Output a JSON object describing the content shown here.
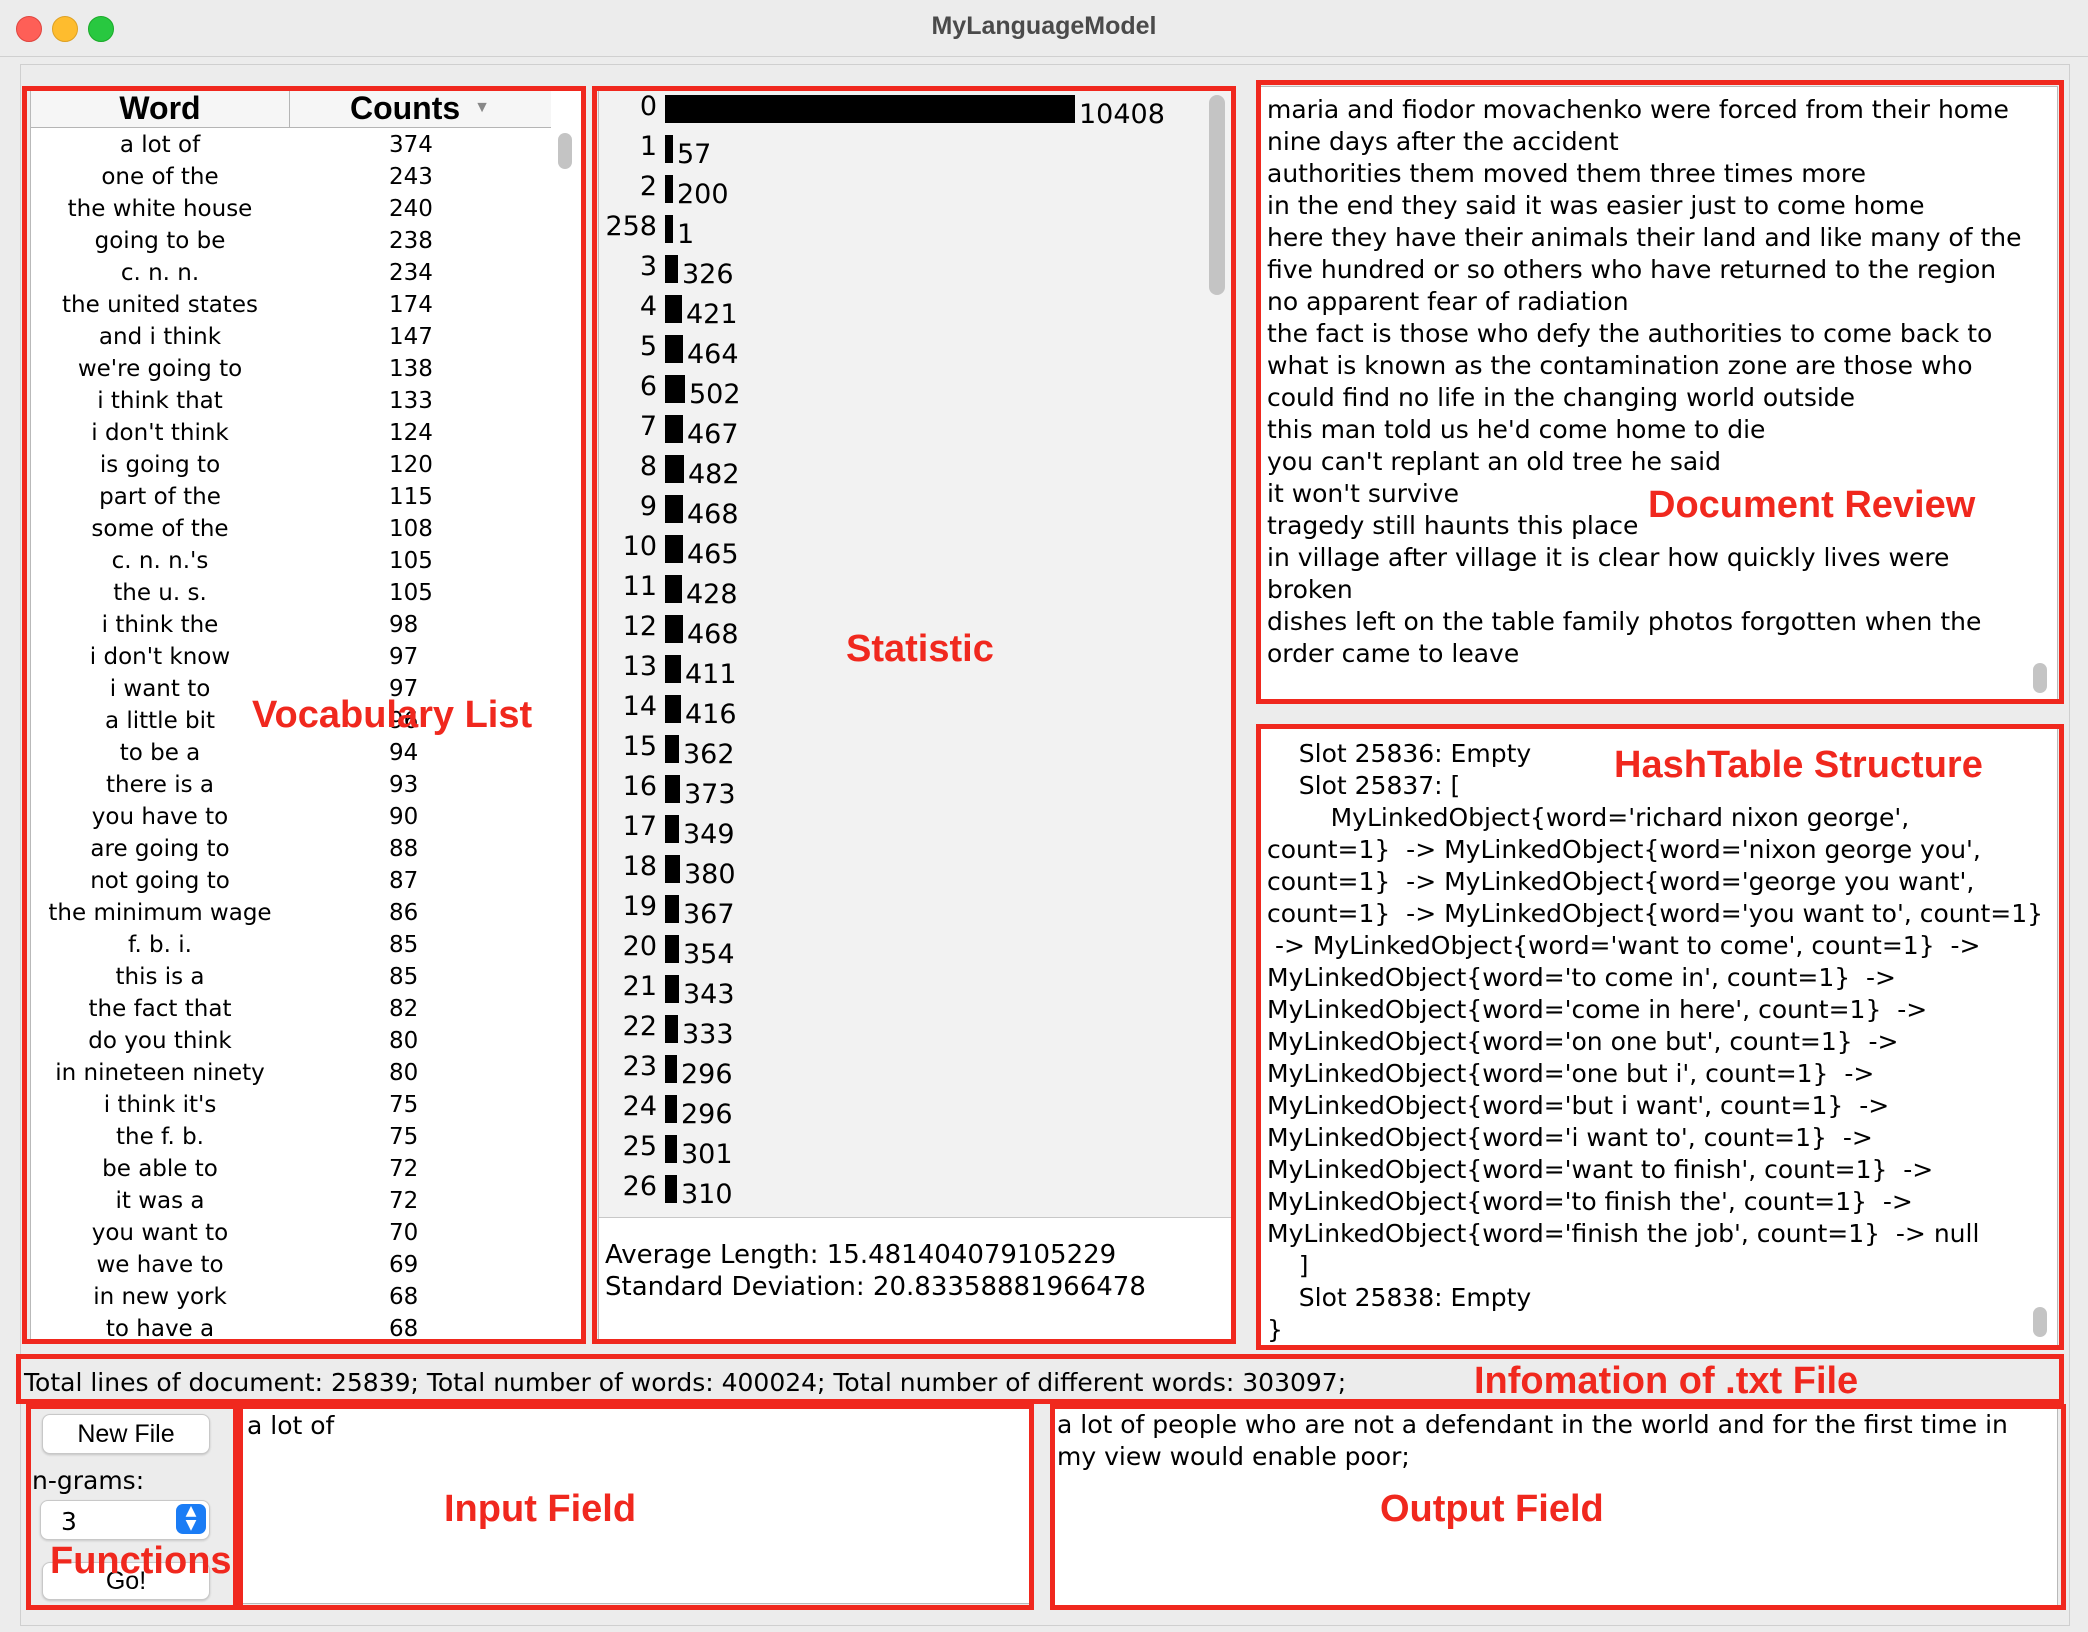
{
  "window": {
    "title": "MyLanguageModel"
  },
  "vocab": {
    "headers": {
      "word": "Word",
      "count": "Counts"
    },
    "rows": [
      [
        "a lot of",
        "374"
      ],
      [
        "one of the",
        "243"
      ],
      [
        "the white house",
        "240"
      ],
      [
        "going to be",
        "238"
      ],
      [
        "c. n. n.",
        "234"
      ],
      [
        "the united states",
        "174"
      ],
      [
        "and i think",
        "147"
      ],
      [
        "we're going to",
        "138"
      ],
      [
        "i think that",
        "133"
      ],
      [
        "i don't think",
        "124"
      ],
      [
        "is going to",
        "120"
      ],
      [
        "part of the",
        "115"
      ],
      [
        "some of the",
        "108"
      ],
      [
        "c. n. n.'s",
        "105"
      ],
      [
        "the u. s.",
        "105"
      ],
      [
        "i think the",
        "98"
      ],
      [
        "i don't know",
        "97"
      ],
      [
        "i want to",
        "97"
      ],
      [
        "a little bit",
        "96"
      ],
      [
        "to be a",
        "94"
      ],
      [
        "there is a",
        "93"
      ],
      [
        "you have to",
        "90"
      ],
      [
        "are going to",
        "88"
      ],
      [
        "not going to",
        "87"
      ],
      [
        "the minimum wage",
        "86"
      ],
      [
        "f. b. i.",
        "85"
      ],
      [
        "this is a",
        "85"
      ],
      [
        "the fact that",
        "82"
      ],
      [
        "do you think",
        "80"
      ],
      [
        "in nineteen ninety",
        "80"
      ],
      [
        "i think it's",
        "75"
      ],
      [
        "the f. b.",
        "75"
      ],
      [
        "be able to",
        "72"
      ],
      [
        "it was a",
        "72"
      ],
      [
        "you want to",
        "70"
      ],
      [
        "we have to",
        "69"
      ],
      [
        "in new york",
        "68"
      ],
      [
        "to have a",
        "68"
      ]
    ]
  },
  "statistic": {
    "histogram": [
      {
        "length": "0",
        "count": 10408
      },
      {
        "length": "1",
        "count": 57
      },
      {
        "length": "2",
        "count": 200
      },
      {
        "length": "258",
        "count": 1
      },
      {
        "length": "3",
        "count": 326
      },
      {
        "length": "4",
        "count": 421
      },
      {
        "length": "5",
        "count": 464
      },
      {
        "length": "6",
        "count": 502
      },
      {
        "length": "7",
        "count": 467
      },
      {
        "length": "8",
        "count": 482
      },
      {
        "length": "9",
        "count": 468
      },
      {
        "length": "10",
        "count": 465
      },
      {
        "length": "11",
        "count": 428
      },
      {
        "length": "12",
        "count": 468
      },
      {
        "length": "13",
        "count": 411
      },
      {
        "length": "14",
        "count": 416
      },
      {
        "length": "15",
        "count": 362
      },
      {
        "length": "16",
        "count": 373
      },
      {
        "length": "17",
        "count": 349
      },
      {
        "length": "18",
        "count": 380
      },
      {
        "length": "19",
        "count": 367
      },
      {
        "length": "20",
        "count": 354
      },
      {
        "length": "21",
        "count": 343
      },
      {
        "length": "22",
        "count": 333
      },
      {
        "length": "23",
        "count": 296
      },
      {
        "length": "24",
        "count": 296
      },
      {
        "length": "25",
        "count": 301
      },
      {
        "length": "26",
        "count": 310
      }
    ],
    "average": "Average Length: 15.481404079105229",
    "stddev": "Standard Deviation: 20.83358881966478"
  },
  "document": {
    "lines": [
      "maria and fiodor movachenko were forced from their home",
      "nine days after the accident",
      "authorities them moved them three times more",
      "in the end they said it was easier just to come home",
      "here they have their animals their land and like many of the",
      "five hundred or so others who have returned to the region",
      "no apparent fear of radiation",
      "the fact is those who defy the authorities to come back to",
      "what is known as the contamination zone are those who",
      "could find no life in the changing world outside",
      "this man told us he'd come home to die",
      "you can't replant an old tree he said",
      "it won't survive",
      "tragedy still haunts this place",
      "in village after village it is clear how quickly lives were",
      "broken",
      "dishes left on the table family photos forgotten when the",
      "order came to leave"
    ]
  },
  "hashtable": {
    "lines": [
      "    Slot 25836: Empty",
      "    Slot 25837: [",
      "        MyLinkedObject{word='richard nixon george',",
      "count=1}  -> MyLinkedObject{word='nixon george you',",
      "count=1}  -> MyLinkedObject{word='george you want',",
      "count=1}  -> MyLinkedObject{word='you want to', count=1}",
      " -> MyLinkedObject{word='want to come', count=1}  ->",
      "MyLinkedObject{word='to come in', count=1}  ->",
      "MyLinkedObject{word='come in here', count=1}  ->",
      "MyLinkedObject{word='on one but', count=1}  ->",
      "MyLinkedObject{word='one but i', count=1}  ->",
      "MyLinkedObject{word='but i want', count=1}  ->",
      "MyLinkedObject{word='i want to', count=1}  ->",
      "MyLinkedObject{word='want to finish', count=1}  ->",
      "MyLinkedObject{word='to finish the', count=1}  ->",
      "MyLinkedObject{word='finish the job', count=1}  -> null",
      "    ]",
      "    Slot 25838: Empty",
      "}"
    ]
  },
  "info": {
    "text": "Total lines of document: 25839; Total number of words: 400024;  Total number of different words: 303097;"
  },
  "controls": {
    "new_file": "New File",
    "ngrams_label": "n-grams:",
    "ngrams_value": "3",
    "go": "Go!"
  },
  "input": {
    "text": "a lot of"
  },
  "output": {
    "text": "a lot of people who are not a defendant in the world and for the first time in my view would enable poor;"
  },
  "annotations": {
    "vocab": "Vocabulary List",
    "statistic": "Statistic",
    "document": "Document Review",
    "hashtable": "HashTable Structure",
    "info": "Infomation of .txt File",
    "input": "Input Field",
    "output": "Output Field",
    "functions": "Functions"
  },
  "colors": {
    "annotation": "#f0281e",
    "bar": "#000000",
    "stepper": "#1a7cf5"
  }
}
